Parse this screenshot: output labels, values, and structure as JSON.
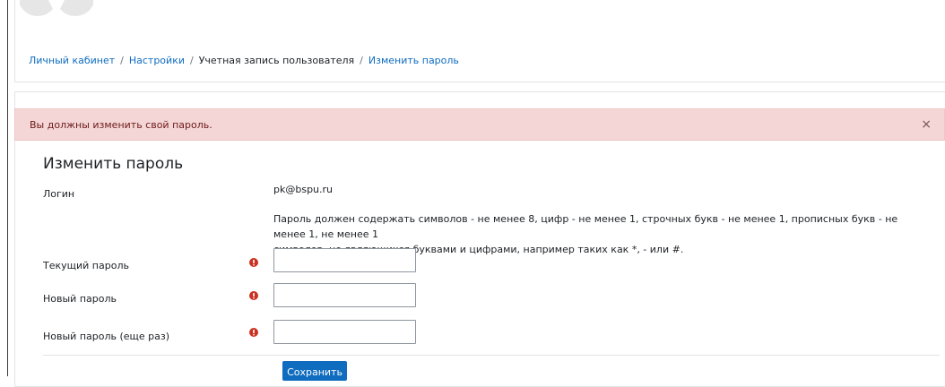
{
  "breadcrumb": {
    "items": [
      {
        "label": "Личный кабинет",
        "link": true
      },
      {
        "label": "Настройки",
        "link": true
      },
      {
        "label": "Учетная запись пользователя",
        "link": false
      },
      {
        "label": "Изменить пароль",
        "link": true
      }
    ],
    "separator": "/"
  },
  "alert": {
    "message": "Вы должны изменить свой пароль.",
    "close_glyph": "×"
  },
  "form": {
    "title": "Изменить пароль",
    "login_label": "Логин",
    "login_value": "pk@bspu.ru",
    "rules_line1": "Пароль должен содержать символов - не менее 8, цифр - не менее 1, строчных букв - не менее 1, прописных букв - не менее 1, не менее 1",
    "rules_line2": "символов, не являющихся буквами и цифрами, например таких как *, - или #.",
    "fields": [
      {
        "label": "Текущий пароль",
        "value": ""
      },
      {
        "label": "Новый пароль",
        "value": ""
      },
      {
        "label": "Новый пароль (еще раз)",
        "value": ""
      }
    ],
    "save_label": "Сохранить"
  },
  "colors": {
    "link": "#0f6cbf",
    "alert_bg": "#f4d6d6",
    "required": "#ca3120",
    "primary_button": "#0f6cbf"
  },
  "icons": {
    "required": "exclamation-circle-icon",
    "close": "close-icon"
  }
}
